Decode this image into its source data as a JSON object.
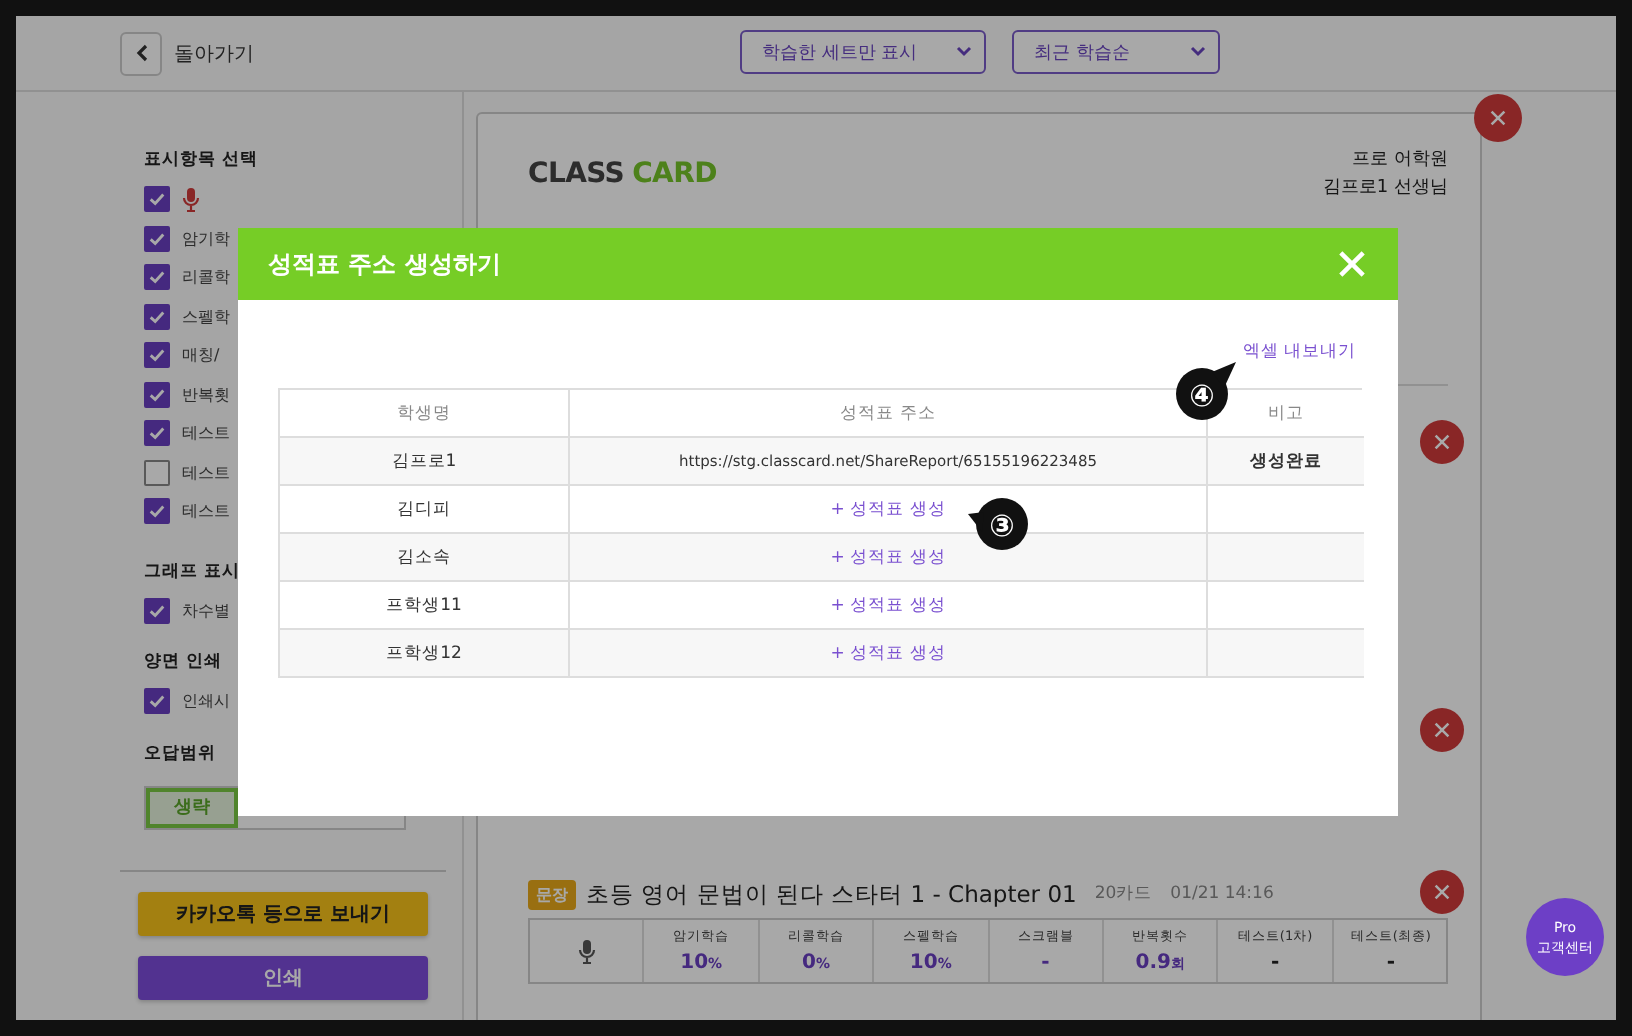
{
  "header": {
    "back_label": "돌아가기",
    "filters": [
      {
        "label": "학습한 세트만 표시"
      },
      {
        "label": "최근 학습순"
      }
    ]
  },
  "sidebar": {
    "sections": [
      {
        "title": "표시항목 선택",
        "options": [
          {
            "kind": "mic",
            "checked": true
          },
          {
            "kind": "text",
            "label": "암기학",
            "checked": true
          },
          {
            "kind": "text",
            "label": "리콜학",
            "checked": true
          },
          {
            "kind": "text",
            "label": "스펠학",
            "checked": true
          },
          {
            "kind": "text",
            "label": "매칭/",
            "checked": true
          },
          {
            "kind": "text",
            "label": "반복횟",
            "checked": true
          },
          {
            "kind": "text",
            "label": "테스트",
            "checked": true
          },
          {
            "kind": "text",
            "label": "테스트",
            "checked": false
          },
          {
            "kind": "text",
            "label": "테스트",
            "checked": true
          }
        ]
      },
      {
        "title": "그래프 표시",
        "options": [
          {
            "kind": "text",
            "label": "차수별",
            "checked": true
          }
        ]
      },
      {
        "title": "양면 인쇄",
        "options": [
          {
            "kind": "text",
            "label": "인쇄시",
            "checked": true
          }
        ]
      }
    ],
    "range": {
      "title": "오답범위",
      "options": [
        {
          "label": "생략",
          "selected": true
        }
      ]
    },
    "buttons": [
      {
        "kind": "kakao",
        "label": "카카오톡 등으로 보내기"
      },
      {
        "kind": "print",
        "label": "인쇄"
      }
    ]
  },
  "report": {
    "logo": {
      "main": "CLASS",
      "accent": "CARD"
    },
    "academy": "프로 어학원",
    "teacher": "김프로1 선생님",
    "sets": [
      {
        "kind": "covered"
      },
      {
        "kind": "covered"
      },
      {
        "kind": "set",
        "tag": "문장",
        "title": "초등 영어 문법이 된다 스타터 1 - Chapter 01",
        "cards": "20카드",
        "date": "01/21 14:16",
        "columns": [
          {
            "kind": "mic"
          },
          {
            "kind": "stat",
            "label": "암기학습",
            "value": "10",
            "unit": "%"
          },
          {
            "kind": "stat",
            "label": "리콜학습",
            "value": "0",
            "unit": "%"
          },
          {
            "kind": "stat",
            "label": "스펠학습",
            "value": "10",
            "unit": "%"
          },
          {
            "kind": "stat",
            "label": "스크램블",
            "value": "-"
          },
          {
            "kind": "stat",
            "label": "반복횟수",
            "value": "0.9",
            "unit": "회"
          },
          {
            "kind": "plain",
            "label": "테스트(1차)",
            "value": "-"
          },
          {
            "kind": "plain",
            "label": "테스트(최종)",
            "value": "-"
          }
        ]
      }
    ]
  },
  "modal": {
    "title": "성적표 주소 생성하기",
    "excel_link": "엑셀 내보내기",
    "columns": [
      "학생명",
      "성적표 주소",
      "비고"
    ],
    "rows": [
      {
        "name": "김프로1",
        "kind": "url",
        "address": "https://stg.classcard.net/ShareReport/65155196223485",
        "note": "생성완료"
      },
      {
        "name": "김디피",
        "kind": "action",
        "action": "+ 성적표 생성"
      },
      {
        "name": "김소속",
        "kind": "action",
        "action": "+ 성적표 생성"
      },
      {
        "name": "프학생11",
        "kind": "action",
        "action": "+ 성적표 생성"
      },
      {
        "name": "프학생12",
        "kind": "action",
        "action": "+ 성적표 생성"
      }
    ]
  },
  "callouts": [
    {
      "label": "④"
    },
    {
      "label": "③"
    }
  ],
  "help": {
    "line1": "Pro",
    "line2": "고객센터"
  }
}
